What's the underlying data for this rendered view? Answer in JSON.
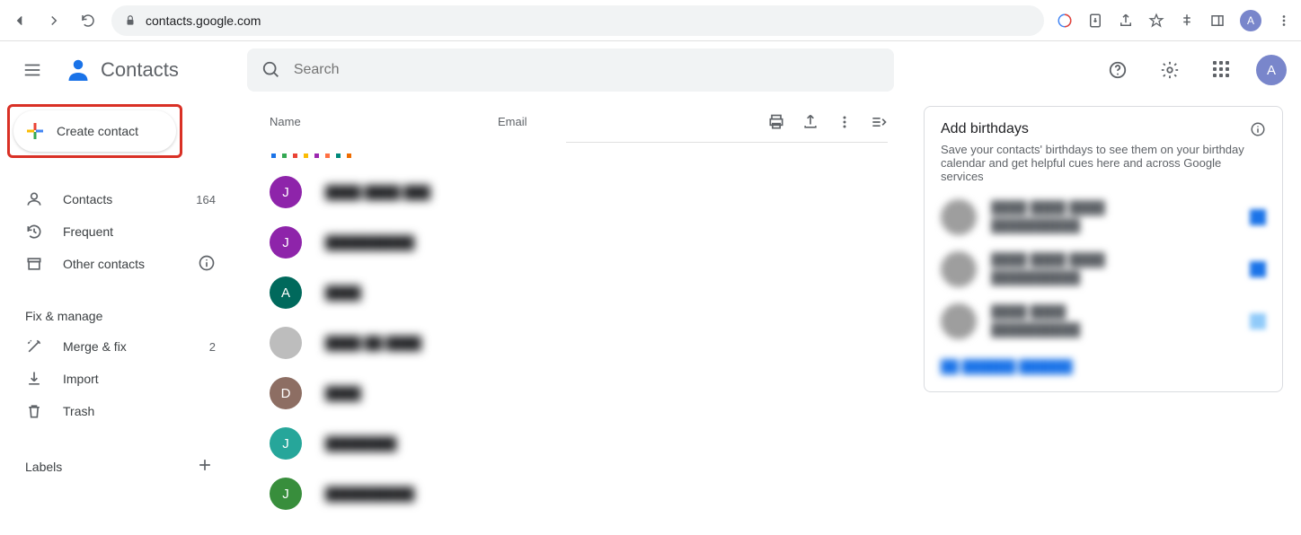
{
  "browser": {
    "url": "contacts.google.com",
    "avatar_letter": "A"
  },
  "app": {
    "name": "Contacts",
    "search_placeholder": "Search",
    "avatar_letter": "A"
  },
  "sidebar": {
    "create_label": "Create contact",
    "contacts_label": "Contacts",
    "contacts_count": "164",
    "frequent_label": "Frequent",
    "other_label": "Other contacts",
    "fix_section": "Fix & manage",
    "merge_label": "Merge & fix",
    "merge_count": "2",
    "import_label": "Import",
    "trash_label": "Trash",
    "labels_label": "Labels"
  },
  "table": {
    "col_name": "Name",
    "col_email": "Email"
  },
  "contacts": [
    {
      "letter": "J",
      "color": "#8e24aa",
      "name": "████ ████ ███"
    },
    {
      "letter": "J",
      "color": "#8e24aa",
      "name": "██████████"
    },
    {
      "letter": "A",
      "color": "#00695c",
      "name": "████"
    },
    {
      "letter": "",
      "color": "#bdbdbd",
      "name": "████ ██ ████"
    },
    {
      "letter": "D",
      "color": "#8d6e63",
      "name": "████"
    },
    {
      "letter": "J",
      "color": "#26a69a",
      "name": "████████"
    },
    {
      "letter": "J",
      "color": "#388e3c",
      "name": "██████████"
    }
  ],
  "card": {
    "title": "Add birthdays",
    "desc": "Save your contacts' birthdays to see them on your birthday calendar and get helpful cues here and across Google services",
    "rows": [
      {
        "name_line1": "████ ████ ████",
        "name_line2": "██████████",
        "icon": "blue"
      },
      {
        "name_line1": "████ ████ ████",
        "name_line2": "██████████",
        "icon": "blue"
      },
      {
        "name_line1": "████ ████",
        "name_line2": "██████████",
        "icon": "lblue"
      }
    ],
    "more": "██ ██████ ██████"
  }
}
